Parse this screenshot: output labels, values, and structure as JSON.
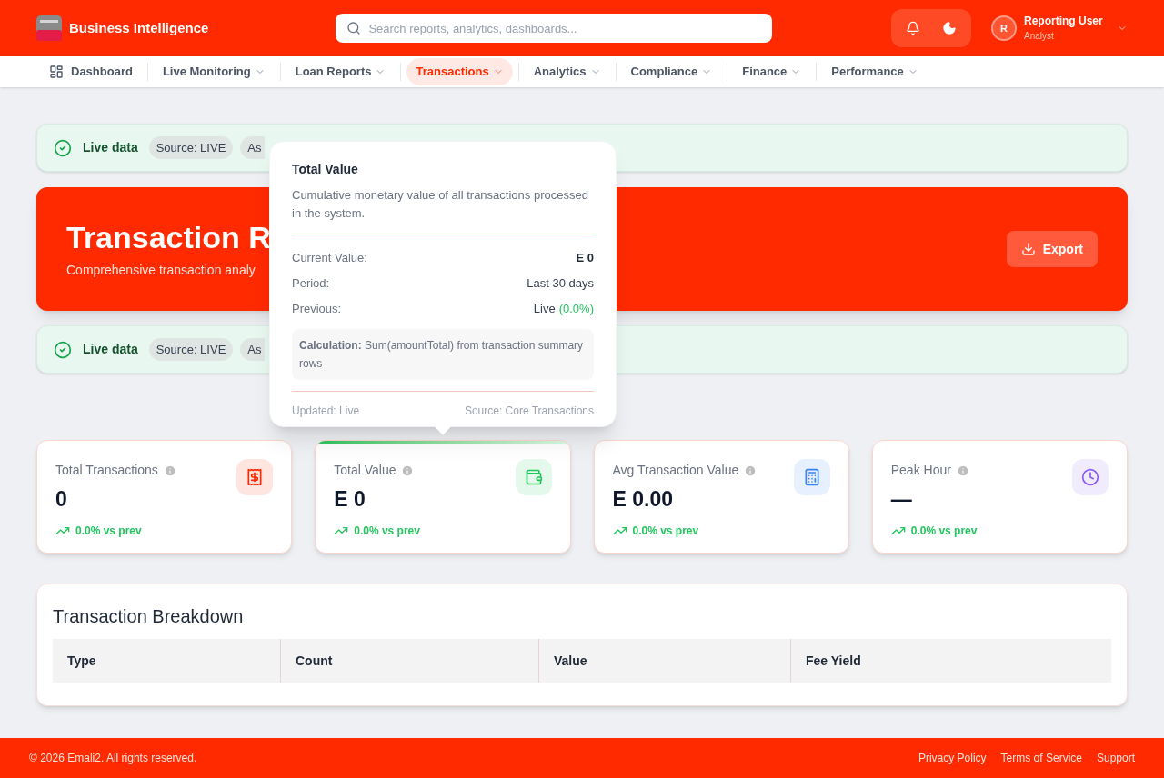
{
  "header": {
    "brand": "Business Intelligence",
    "search": {
      "placeholder": "Search reports, analytics, dashboards..."
    },
    "user": {
      "initial": "R",
      "name": "Reporting User",
      "role": "Analyst"
    }
  },
  "nav": [
    {
      "label": "Dashboard",
      "selected": false,
      "kind": "link"
    },
    {
      "label": "Live Monitoring",
      "selected": false,
      "kind": "dropdown"
    },
    {
      "label": "Loan Reports",
      "selected": false,
      "kind": "dropdown"
    },
    {
      "label": "Transactions",
      "selected": true,
      "kind": "dropdown"
    },
    {
      "label": "Analytics",
      "selected": false,
      "kind": "dropdown"
    },
    {
      "label": "Compliance",
      "selected": false,
      "kind": "dropdown"
    },
    {
      "label": "Finance",
      "selected": false,
      "kind": "dropdown"
    },
    {
      "label": "Performance",
      "selected": false,
      "kind": "dropdown"
    }
  ],
  "status_top": {
    "label": "Live data",
    "source": "Source: LIVE",
    "as_of": "As"
  },
  "hero": {
    "title": "Transaction R",
    "subtitle": "Comprehensive transaction analy",
    "export": "Export"
  },
  "status_bottom": {
    "label": "Live data",
    "source": "Source: LIVE",
    "as_of": "As"
  },
  "tooltip": {
    "title": "Total Value",
    "description": "Cumulative monetary value of all transactions processed in the system.",
    "rows": [
      {
        "label": "Current Value:",
        "value": "E 0"
      },
      {
        "label": "Period:",
        "value": "Last 30 days"
      },
      {
        "label": "Previous:",
        "value": "Live",
        "change": "(0.0%)"
      }
    ],
    "calculation": "**Calculation:** Sum(amountTotal) from transaction summary rows",
    "updated": "Updated: Live",
    "source": "Source: Core Transactions"
  },
  "kpis": [
    {
      "title": "Total Transactions",
      "value": "0",
      "change": "0.0% vs prev",
      "kind": "receipt",
      "color": "#ff2a00",
      "selected": false
    },
    {
      "title": "Total Value",
      "value": "E 0",
      "change": "0.0% vs prev",
      "kind": "wallet",
      "color": "#22c55e",
      "selected": true
    },
    {
      "title": "Avg Transaction Value",
      "value": "E 0.00",
      "change": "0.0% vs prev",
      "kind": "calculator",
      "color": "#3b82f6",
      "selected": false
    },
    {
      "title": "Peak Hour",
      "value": "—",
      "change": "0.0% vs prev",
      "kind": "clock",
      "color": "#8b5cf6",
      "selected": false
    }
  ],
  "breakdown": {
    "title": "Transaction Breakdown",
    "columns": [
      "Type",
      "Count",
      "Value",
      "Fee Yield"
    ]
  },
  "footer": {
    "copyright": "© 2026 Emali2. All rights reserved.",
    "links": [
      "Privacy Policy",
      "Terms of Service",
      "Support"
    ]
  }
}
